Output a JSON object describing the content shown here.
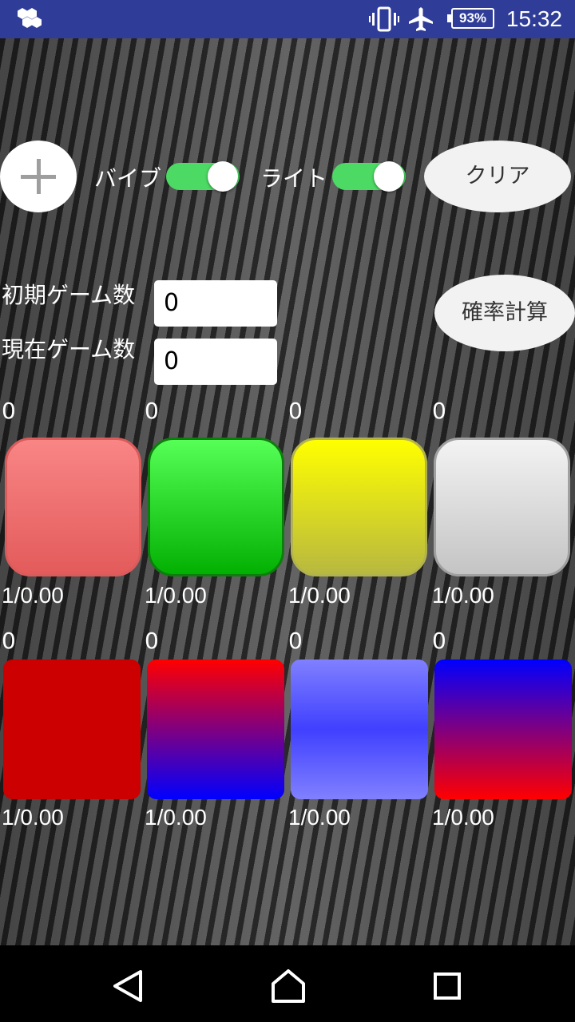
{
  "status_bar": {
    "time": "15:32",
    "battery": "93%",
    "icons": [
      "app-icon",
      "vibrate-icon",
      "airplane-icon",
      "battery-icon"
    ]
  },
  "controls": {
    "vibe_label": "バイブ",
    "vibe_on": true,
    "light_label": "ライト",
    "light_on": true,
    "clear_label": "クリア",
    "calc_label": "確率計算"
  },
  "fields": {
    "initial_games_label": "初期ゲーム数",
    "initial_games_value": "0",
    "current_games_label": "現在ゲーム数",
    "current_games_value": "0"
  },
  "counters_row1": [
    {
      "count": "0",
      "ratio": "1/0.00",
      "color": "#f98585"
    },
    {
      "count": "0",
      "ratio": "1/0.00",
      "color": "#22e022"
    },
    {
      "count": "0",
      "ratio": "1/0.00",
      "color": "#ffff00"
    },
    {
      "count": "0",
      "ratio": "1/0.00",
      "color": "#e0e0e0"
    }
  ],
  "counters_row2": [
    {
      "count": "0",
      "ratio": "1/0.00",
      "color": "#cc0000"
    },
    {
      "count": "0",
      "ratio": "1/0.00",
      "color": "#ff0000-#0000ff"
    },
    {
      "count": "0",
      "ratio": "1/0.00",
      "color": "#6060ff"
    },
    {
      "count": "0",
      "ratio": "1/0.00",
      "color": "#0000ff-#ff0000"
    }
  ],
  "nav": [
    "back-icon",
    "home-icon",
    "recents-icon"
  ]
}
